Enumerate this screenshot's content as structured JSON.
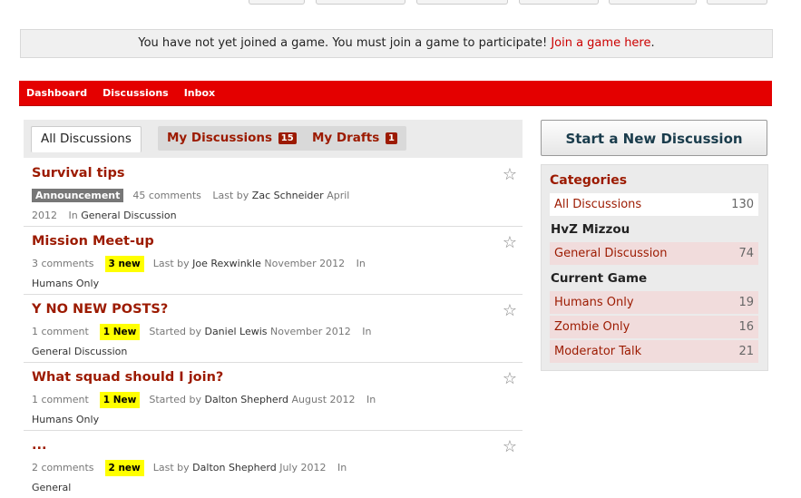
{
  "notice": {
    "text": "You have not yet joined a game. You must join a game to participate!",
    "link": "Join a game here",
    "suffix": "."
  },
  "menu": [
    "Dashboard",
    "Discussions",
    "Inbox"
  ],
  "tabs": {
    "all": "All Discussions",
    "mine": "My Discussions",
    "mine_count": "15",
    "drafts": "My Drafts",
    "drafts_count": "1"
  },
  "discussions": [
    {
      "title": "Survival tips",
      "tag": "Announcement",
      "comments": "45 comments",
      "action": "Last by",
      "user": "Zac Schneider",
      "date": "April 2012",
      "in": "In",
      "category": "General Discussion"
    },
    {
      "title": "Mission Meet-up",
      "comments": "3 comments",
      "new": "3 new",
      "action": "Last by",
      "user": "Joe Rexwinkle",
      "date": "November 2012",
      "in": "In",
      "category": "Humans Only"
    },
    {
      "title": "Y NO NEW POSTS?",
      "comments": "1 comment",
      "new": "1 New",
      "action": "Started by",
      "user": "Daniel Lewis",
      "date": "November 2012",
      "in": "In",
      "category": "General Discussion"
    },
    {
      "title": "What squad should I join?",
      "comments": "1 comment",
      "new": "1 New",
      "action": "Started by",
      "user": "Dalton Shepherd",
      "date": "August 2012",
      "in": "In",
      "category": "Humans Only"
    },
    {
      "title": "...",
      "comments": "2 comments",
      "new": "2 new",
      "action": "Last by",
      "user": "Dalton Shepherd",
      "date": "July 2012",
      "in": "In",
      "category": "General"
    }
  ],
  "start_button": "Start a New Discussion",
  "categories": {
    "heading": "Categories",
    "all": {
      "label": "All Discussions",
      "count": "130"
    },
    "group1": "HvZ Mizzou",
    "general": {
      "label": "General Discussion",
      "count": "74"
    },
    "group2": "Current Game",
    "humans": {
      "label": "Humans Only",
      "count": "19"
    },
    "zombie": {
      "label": "Zombie Only",
      "count": "16"
    },
    "moderator": {
      "label": "Moderator Talk",
      "count": "21"
    }
  },
  "icons": {
    "star": "star-outline-icon"
  }
}
